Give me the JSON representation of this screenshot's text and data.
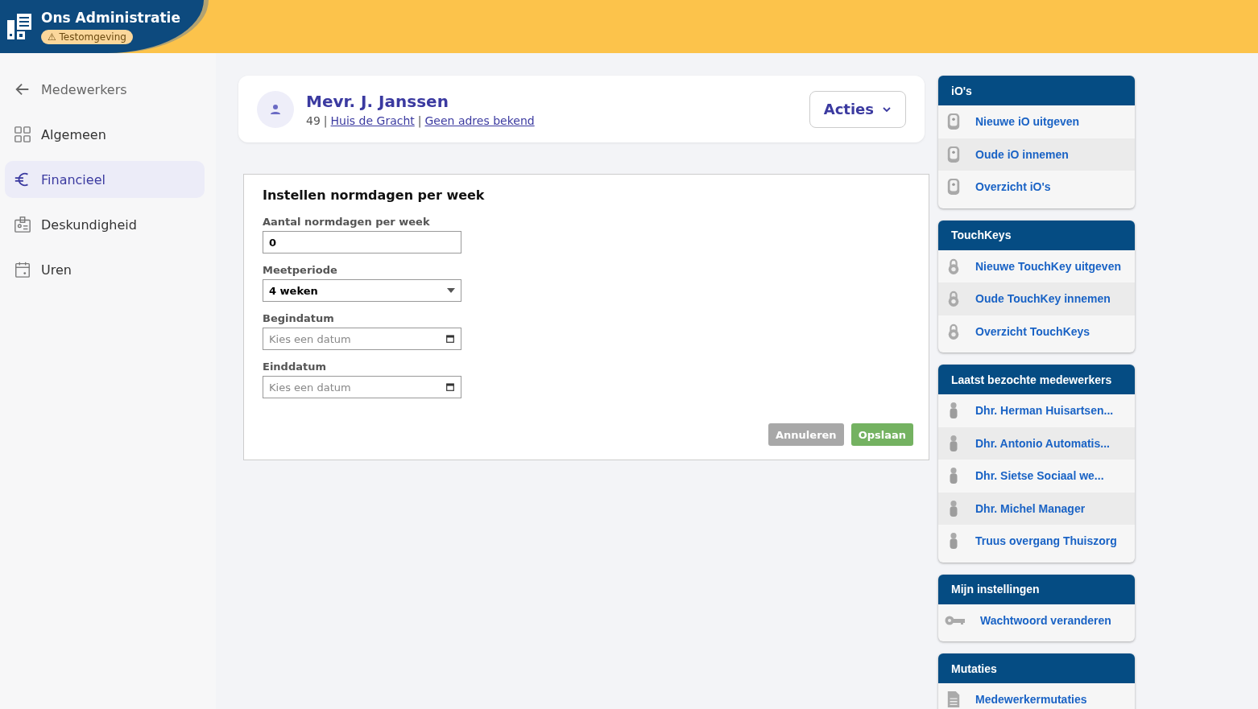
{
  "app": {
    "title": "Ons Administratie",
    "environment_badge": "⚠ Testomgeving"
  },
  "sidebar": {
    "back": {
      "label": "Medewerkers"
    },
    "items": [
      {
        "label": "Algemeen",
        "kind": "grid",
        "selected": false
      },
      {
        "label": "Financieel",
        "kind": "euro",
        "selected": true
      },
      {
        "label": "Deskundigheid",
        "kind": "badge",
        "selected": false
      },
      {
        "label": "Uren",
        "kind": "calendar",
        "selected": false
      }
    ]
  },
  "profile": {
    "name": "Mevr. J. Janssen",
    "number": "49",
    "location_link": "Huis de Gracht",
    "address_link": "Geen adres bekend",
    "separator": "|",
    "actions_button": "Acties"
  },
  "form": {
    "title": "Instellen normdagen per week",
    "fields": [
      {
        "label": "Aantal normdagen per week",
        "kind": "text",
        "value": "0"
      },
      {
        "label": "Meetperiode",
        "kind": "select",
        "value": "4 weken"
      },
      {
        "label": "Begindatum",
        "kind": "date",
        "placeholder": "Kies een datum"
      },
      {
        "label": "Einddatum",
        "kind": "date",
        "placeholder": "Kies een datum"
      }
    ],
    "buttons": [
      {
        "label": "Annuleren",
        "kind": "cancel"
      },
      {
        "label": "Opslaan",
        "kind": "save"
      }
    ]
  },
  "panels": [
    {
      "title": "iO's",
      "items": [
        {
          "label": "Nieuwe iO uitgeven",
          "kind": "fob"
        },
        {
          "label": "Oude iO innemen",
          "kind": "fob"
        },
        {
          "label": "Overzicht iO's",
          "kind": "fob"
        }
      ]
    },
    {
      "title": "TouchKeys",
      "items": [
        {
          "label": "Nieuwe TouchKey uitgeven",
          "kind": "lock"
        },
        {
          "label": "Oude TouchKey innemen",
          "kind": "lock"
        },
        {
          "label": "Overzicht TouchKeys",
          "kind": "lock"
        }
      ]
    },
    {
      "title": "Laatst bezochte medewerkers",
      "items": [
        {
          "label": "Dhr. Herman Huisartsen...",
          "kind": "person"
        },
        {
          "label": "Dhr. Antonio Automatis...",
          "kind": "person"
        },
        {
          "label": "Dhr. Sietse Sociaal we...",
          "kind": "person"
        },
        {
          "label": "Dhr. Michel Manager",
          "kind": "person"
        },
        {
          "label": "Truus overgang Thuiszorg",
          "kind": "person"
        }
      ]
    },
    {
      "title": "Mijn instellingen",
      "items": [
        {
          "label": "Wachtwoord veranderen",
          "kind": "key"
        }
      ]
    },
    {
      "title": "Mutaties",
      "items": [
        {
          "label": "Medewerkermutaties",
          "kind": "document"
        }
      ]
    }
  ]
}
